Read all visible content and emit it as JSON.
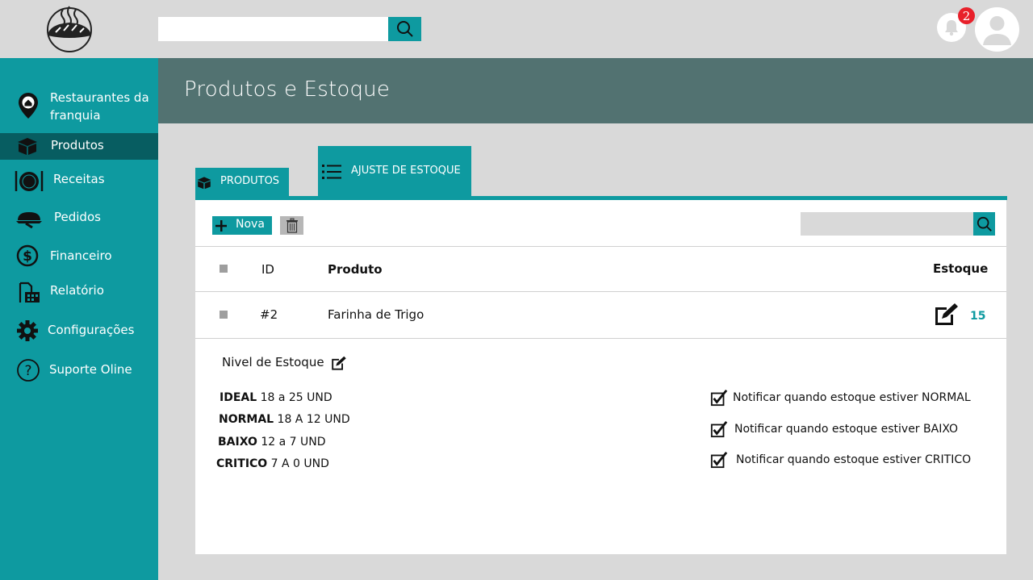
{
  "topbar": {
    "search_placeholder": "",
    "notifications_count": "2"
  },
  "sidebar": {
    "items": [
      {
        "label_line1": "Restaurantes da",
        "label_line2": "franquia",
        "icon": "location-pin-icon"
      },
      {
        "label": "Produtos",
        "icon": "box-icon",
        "active": true
      },
      {
        "label": "Receitas",
        "icon": "plate-icon"
      },
      {
        "label": "Pedidos",
        "icon": "cloche-icon"
      },
      {
        "label": "Financeiro",
        "icon": "dollar-icon"
      },
      {
        "label": "Relatório",
        "icon": "report-icon"
      },
      {
        "label": "Configurações",
        "icon": "gear-icon"
      },
      {
        "label": "Suporte Oline",
        "icon": "help-icon"
      }
    ]
  },
  "header": {
    "title": "Produtos e Estoque"
  },
  "tabs": [
    {
      "label": "PRODUTOS",
      "icon": "box-icon"
    },
    {
      "label": "AJUSTE DE ESTOQUE",
      "icon": "list-icon",
      "active": true
    }
  ],
  "toolbar": {
    "new_label": "Nova",
    "search_placeholder": ""
  },
  "table": {
    "columns": [
      "ID",
      "Produto",
      "Estoque"
    ],
    "rows": [
      {
        "id": "#2",
        "produto": "Farinha de Trigo",
        "estoque": "15"
      }
    ]
  },
  "stock_levels": {
    "title": "Nivel de Estoque",
    "levels": [
      {
        "name": "IDEAL",
        "range": "18 a 25 UND"
      },
      {
        "name": "NORMAL",
        "range": "18 A 12 UND"
      },
      {
        "name": "BAIXO",
        "range": "12 a 7 UND"
      },
      {
        "name": "CRITICO",
        "range": "7 A 0 UND"
      }
    ]
  },
  "notifications": [
    {
      "label": "Notificar quando estoque estiver NORMAL",
      "checked": true
    },
    {
      "label": "Notificar quando estoque estiver BAIXO",
      "checked": true
    },
    {
      "label": "Notificar quando estoque estiver CRITICO",
      "checked": true
    }
  ],
  "colors": {
    "teal": "#0e9aa0",
    "teal_dark": "#075d61",
    "header": "#527271",
    "badge": "#e8202a"
  }
}
